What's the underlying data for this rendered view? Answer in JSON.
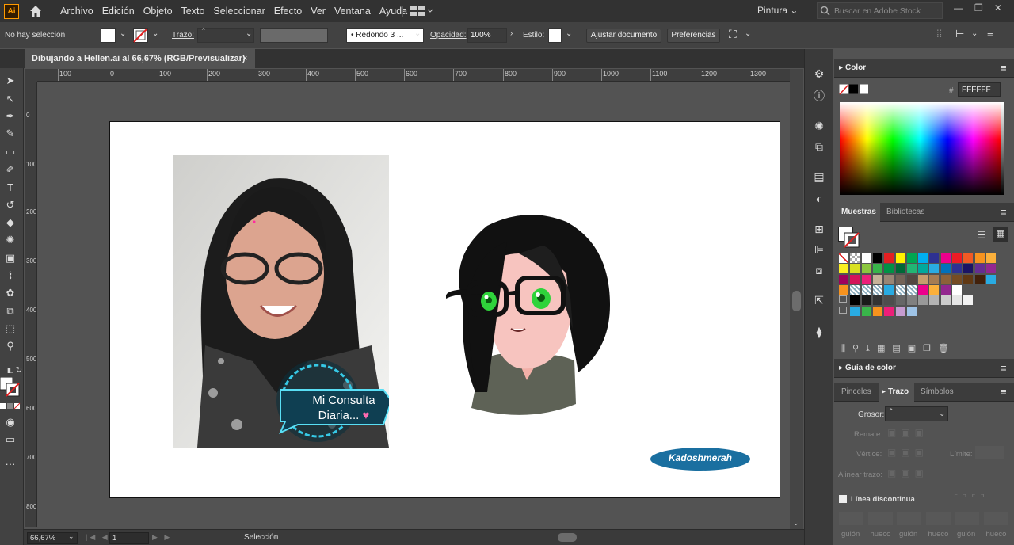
{
  "app": {
    "logo": "Ai",
    "home_icon": "home-icon"
  },
  "menu": [
    "Archivo",
    "Edición",
    "Objeto",
    "Texto",
    "Seleccionar",
    "Efecto",
    "Ver",
    "Ventana",
    "Ayuda"
  ],
  "workspace": "Pintura",
  "stock_search": {
    "placeholder": "Buscar en Adobe Stock"
  },
  "control": {
    "selection": "No hay selección",
    "stroke_label": "Trazo:",
    "brush": "Redondo 3 ...",
    "opacity_label": "Opacidad:",
    "opacity": "100%",
    "style_label": "Estilo:",
    "fit_doc": "Ajustar documento",
    "prefs": "Preferencias"
  },
  "doc_tab": {
    "title": "Dibujando a Hellen.ai al 66,67% (RGB/Previsualizar)",
    "close": "×"
  },
  "ruler_h": [
    "100",
    "0",
    "100",
    "200",
    "300",
    "400",
    "500",
    "600",
    "700",
    "800",
    "900",
    "1000",
    "1100",
    "1200",
    "1300"
  ],
  "ruler_v": [
    "0",
    "100",
    "200",
    "300",
    "400",
    "500",
    "600",
    "700",
    "800"
  ],
  "artwork": {
    "photo_badge_line1": "Mi Consulta",
    "photo_badge_line2": "Diaria...",
    "signature": "Kadoshmerah"
  },
  "status": {
    "zoom": "66,67%",
    "page": "1",
    "tool": "Selección"
  },
  "color_panel": {
    "title": "Color",
    "hex_label": "#",
    "hex": "FFFFFF"
  },
  "swatches_panel": {
    "tab1": "Muestras",
    "tab2": "Bibliotecas"
  },
  "color_guide": {
    "title": "Guía de color"
  },
  "stroke_panel": {
    "tab1": "Pinceles",
    "tab2": "Trazo",
    "tab3": "Símbolos",
    "weight_label": "Grosor:",
    "cap_label": "Remate:",
    "corner_label": "Vértice:",
    "limit_label": "Límite:",
    "align_label": "Alinear trazo:",
    "dashed_label": "Línea discontinua",
    "dash_labels": [
      "guión",
      "hueco",
      "guión",
      "hueco",
      "guión",
      "hueco"
    ]
  },
  "colors": {
    "accent": "#ff9a00",
    "badge": "#1e6e9c",
    "sign_bg": "#1a6fa0"
  }
}
